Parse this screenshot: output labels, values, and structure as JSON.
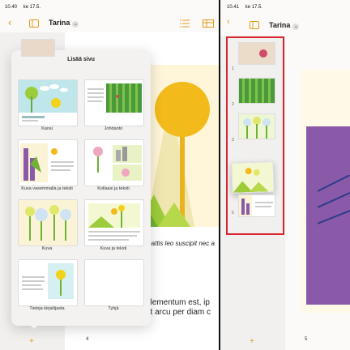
{
  "left": {
    "status": {
      "time": "10.40",
      "date": "ke 17.5."
    },
    "title": "Tarina",
    "popup": {
      "title": "Lisää sivu",
      "templates": [
        {
          "label": "Kansi"
        },
        {
          "label": "Johdanto"
        },
        {
          "label": "Kuva vasemmalla ja teksti"
        },
        {
          "label": "Kollaasi ja teksti"
        },
        {
          "label": "Kuva"
        },
        {
          "label": "Kuva ja teksti"
        },
        {
          "label": "Tietoja kirjailijasta"
        },
        {
          "label": "Tyhjä"
        }
      ]
    },
    "body_text": {
      "l1": "mattis leo suscipit nec a",
      "l2": "elementum est, ip",
      "l3": "et arcu per diam c"
    },
    "page_number": "4",
    "add_symbol": "+"
  },
  "right": {
    "status": {
      "time": "10.41",
      "date": "ke 17.5."
    },
    "title": "Tarina",
    "thumbnails": [
      {
        "num": "1"
      },
      {
        "num": "2"
      },
      {
        "num": "3"
      },
      {
        "num": ""
      },
      {
        "num": "5"
      }
    ],
    "page_number": "5",
    "add_symbol": "+"
  },
  "colors": {
    "accent": "#e39a18",
    "highlight": "#d7262f",
    "purple": "#8a5aa8"
  }
}
